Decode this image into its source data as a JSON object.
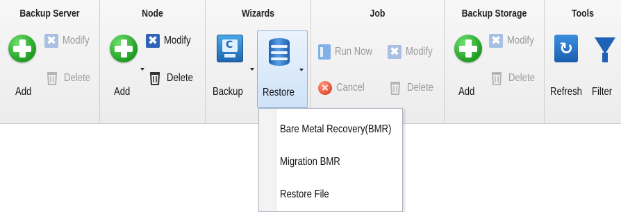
{
  "ribbon": {
    "groups": {
      "backup_server": {
        "title": "Backup Server",
        "add_label": "Add",
        "modify_label": "Modify",
        "delete_label": "Delete"
      },
      "node": {
        "title": "Node",
        "add_label": "Add",
        "modify_label": "Modify",
        "delete_label": "Delete"
      },
      "wizards": {
        "title": "Wizards",
        "backup_label": "Backup",
        "restore_label": "Restore"
      },
      "job": {
        "title": "Job",
        "run_now_label": "Run Now",
        "modify_label": "Modify",
        "cancel_label": "Cancel",
        "delete_label": "Delete"
      },
      "backup_storage": {
        "title": "Backup Storage",
        "add_label": "Add",
        "modify_label": "Modify",
        "delete_label": "Delete"
      },
      "tools": {
        "title": "Tools",
        "refresh_label": "Refresh",
        "filter_label": "Filter"
      }
    }
  },
  "restore_menu": {
    "items": [
      {
        "label": "Bare Metal Recovery(BMR)"
      },
      {
        "label": "Migration BMR"
      },
      {
        "label": "Restore File"
      }
    ]
  },
  "colors": {
    "add_green": "#2aa82d",
    "modify_blue": "#2f64b8",
    "cancel_red": "#e04a2e",
    "disabled_text": "#9a9a9a"
  }
}
